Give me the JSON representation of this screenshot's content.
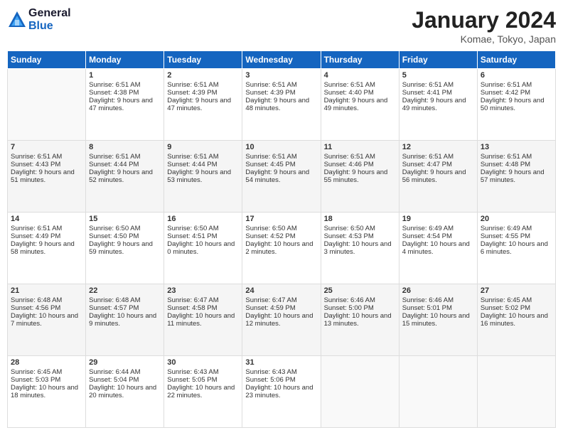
{
  "logo": {
    "line1": "General",
    "line2": "Blue"
  },
  "title": "January 2024",
  "location": "Komae, Tokyo, Japan",
  "days": [
    "Sunday",
    "Monday",
    "Tuesday",
    "Wednesday",
    "Thursday",
    "Friday",
    "Saturday"
  ],
  "weeks": [
    [
      {
        "num": "",
        "empty": true,
        "sunrise": "",
        "sunset": "",
        "daylight": ""
      },
      {
        "num": "1",
        "sunrise": "6:51 AM",
        "sunset": "4:38 PM",
        "daylight": "9 hours and 47 minutes."
      },
      {
        "num": "2",
        "sunrise": "6:51 AM",
        "sunset": "4:39 PM",
        "daylight": "9 hours and 47 minutes."
      },
      {
        "num": "3",
        "sunrise": "6:51 AM",
        "sunset": "4:39 PM",
        "daylight": "9 hours and 48 minutes."
      },
      {
        "num": "4",
        "sunrise": "6:51 AM",
        "sunset": "4:40 PM",
        "daylight": "9 hours and 49 minutes."
      },
      {
        "num": "5",
        "sunrise": "6:51 AM",
        "sunset": "4:41 PM",
        "daylight": "9 hours and 49 minutes."
      },
      {
        "num": "6",
        "sunrise": "6:51 AM",
        "sunset": "4:42 PM",
        "daylight": "9 hours and 50 minutes."
      }
    ],
    [
      {
        "num": "7",
        "sunrise": "6:51 AM",
        "sunset": "4:43 PM",
        "daylight": "9 hours and 51 minutes."
      },
      {
        "num": "8",
        "sunrise": "6:51 AM",
        "sunset": "4:44 PM",
        "daylight": "9 hours and 52 minutes."
      },
      {
        "num": "9",
        "sunrise": "6:51 AM",
        "sunset": "4:44 PM",
        "daylight": "9 hours and 53 minutes."
      },
      {
        "num": "10",
        "sunrise": "6:51 AM",
        "sunset": "4:45 PM",
        "daylight": "9 hours and 54 minutes."
      },
      {
        "num": "11",
        "sunrise": "6:51 AM",
        "sunset": "4:46 PM",
        "daylight": "9 hours and 55 minutes."
      },
      {
        "num": "12",
        "sunrise": "6:51 AM",
        "sunset": "4:47 PM",
        "daylight": "9 hours and 56 minutes."
      },
      {
        "num": "13",
        "sunrise": "6:51 AM",
        "sunset": "4:48 PM",
        "daylight": "9 hours and 57 minutes."
      }
    ],
    [
      {
        "num": "14",
        "sunrise": "6:51 AM",
        "sunset": "4:49 PM",
        "daylight": "9 hours and 58 minutes."
      },
      {
        "num": "15",
        "sunrise": "6:50 AM",
        "sunset": "4:50 PM",
        "daylight": "9 hours and 59 minutes."
      },
      {
        "num": "16",
        "sunrise": "6:50 AM",
        "sunset": "4:51 PM",
        "daylight": "10 hours and 0 minutes."
      },
      {
        "num": "17",
        "sunrise": "6:50 AM",
        "sunset": "4:52 PM",
        "daylight": "10 hours and 2 minutes."
      },
      {
        "num": "18",
        "sunrise": "6:50 AM",
        "sunset": "4:53 PM",
        "daylight": "10 hours and 3 minutes."
      },
      {
        "num": "19",
        "sunrise": "6:49 AM",
        "sunset": "4:54 PM",
        "daylight": "10 hours and 4 minutes."
      },
      {
        "num": "20",
        "sunrise": "6:49 AM",
        "sunset": "4:55 PM",
        "daylight": "10 hours and 6 minutes."
      }
    ],
    [
      {
        "num": "21",
        "sunrise": "6:48 AM",
        "sunset": "4:56 PM",
        "daylight": "10 hours and 7 minutes."
      },
      {
        "num": "22",
        "sunrise": "6:48 AM",
        "sunset": "4:57 PM",
        "daylight": "10 hours and 9 minutes."
      },
      {
        "num": "23",
        "sunrise": "6:47 AM",
        "sunset": "4:58 PM",
        "daylight": "10 hours and 11 minutes."
      },
      {
        "num": "24",
        "sunrise": "6:47 AM",
        "sunset": "4:59 PM",
        "daylight": "10 hours and 12 minutes."
      },
      {
        "num": "25",
        "sunrise": "6:46 AM",
        "sunset": "5:00 PM",
        "daylight": "10 hours and 13 minutes."
      },
      {
        "num": "26",
        "sunrise": "6:46 AM",
        "sunset": "5:01 PM",
        "daylight": "10 hours and 15 minutes."
      },
      {
        "num": "27",
        "sunrise": "6:45 AM",
        "sunset": "5:02 PM",
        "daylight": "10 hours and 16 minutes."
      }
    ],
    [
      {
        "num": "28",
        "sunrise": "6:45 AM",
        "sunset": "5:03 PM",
        "daylight": "10 hours and 18 minutes."
      },
      {
        "num": "29",
        "sunrise": "6:44 AM",
        "sunset": "5:04 PM",
        "daylight": "10 hours and 20 minutes."
      },
      {
        "num": "30",
        "sunrise": "6:43 AM",
        "sunset": "5:05 PM",
        "daylight": "10 hours and 22 minutes."
      },
      {
        "num": "31",
        "sunrise": "6:43 AM",
        "sunset": "5:06 PM",
        "daylight": "10 hours and 23 minutes."
      },
      {
        "num": "",
        "empty": true
      },
      {
        "num": "",
        "empty": true
      },
      {
        "num": "",
        "empty": true
      }
    ]
  ]
}
